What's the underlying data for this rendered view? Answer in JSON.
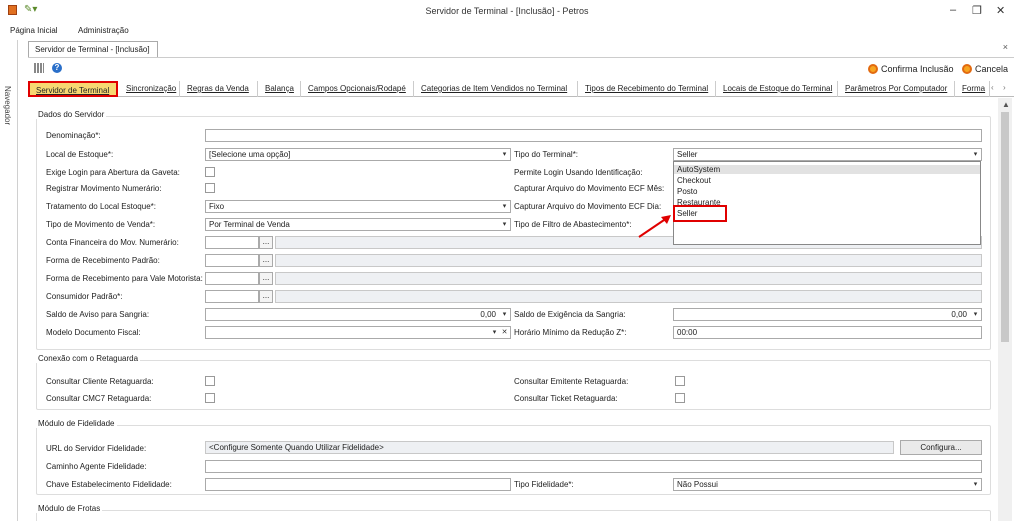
{
  "app": {
    "title": "Servidor de Terminal - [Inclusão] - Petros"
  },
  "window_controls": {
    "minimize": "–",
    "restore": "❐",
    "close": "✕"
  },
  "menu": {
    "items": [
      "Página Inicial",
      "Administração"
    ]
  },
  "navigator": {
    "label": "Navegador"
  },
  "doc_tab": {
    "label": "Servidor de Terminal - [Inclusão]",
    "close": "×"
  },
  "toolbar": {
    "confirm": "Confirma Inclusão",
    "cancel": "Cancela"
  },
  "tabs": [
    "Servidor de Terminal",
    "Sincronização",
    "Regras da Venda",
    "Balança",
    "Campos Opcionais/Rodapé",
    "Categorias de Item Vendidos no Terminal",
    "Tipos de Recebimento do Terminal",
    "Locais de Estoque do Terminal",
    "Parâmetros Por Computador",
    "Forma"
  ],
  "groups": {
    "dados": "Dados do Servidor",
    "conexao": "Conexão com o Retaguarda",
    "fidelidade": "Módulo de Fidelidade",
    "frotas": "Módulo de Frotas"
  },
  "form": {
    "denominacao": {
      "label": "Denominação*:",
      "value": ""
    },
    "local_estoque": {
      "label": "Local de Estoque*:",
      "value": "[Selecione uma opção]"
    },
    "exige_login": {
      "label": "Exige Login para Abertura da Gaveta:"
    },
    "registrar_mov": {
      "label": "Registrar Movimento Numerário:"
    },
    "tratamento": {
      "label": "Tratamento do Local Estoque*:",
      "value": "Fixo"
    },
    "tipo_mov": {
      "label": "Tipo de Movimento de Venda*:",
      "value": "Por Terminal de Venda"
    },
    "conta_fin": {
      "label": "Conta Financeira do Mov. Numerário:"
    },
    "forma_receb": {
      "label": "Forma de Recebimento Padrão:"
    },
    "forma_vale": {
      "label": "Forma de Recebimento para Vale Motorista:"
    },
    "consumidor": {
      "label": "Consumidor Padrão*:"
    },
    "saldo_aviso": {
      "label": "Saldo de Aviso para Sangria:",
      "value": "0,00"
    },
    "modelo_doc": {
      "label": "Modelo Documento Fiscal:"
    },
    "tipo_terminal": {
      "label": "Tipo do Terminal*:",
      "value": "Seller"
    },
    "permite_login": {
      "label": "Permite Login Usando Identificação:"
    },
    "capt_mes": {
      "label": "Capturar Arquivo do Movimento ECF Mês:"
    },
    "capt_dia": {
      "label": "Capturar Arquivo do Movimento ECF Dia:"
    },
    "tipo_filtro": {
      "label": "Tipo de Filtro de Abastecimento*:"
    },
    "saldo_exig": {
      "label": "Saldo de Exigência da Sangria:",
      "value": "0,00"
    },
    "horario": {
      "label": "Horário Mínimo da Redução Z*:",
      "value": "00:00"
    }
  },
  "dropdown_options": [
    "AutoSystem",
    "Checkout",
    "Posto",
    "Restaurante",
    "Seller"
  ],
  "conexao": {
    "cliente": "Consultar Cliente Retaguarda:",
    "cmc7": "Consultar CMC7 Retaguarda:",
    "emitente": "Consultar Emitente Retaguarda:",
    "ticket": "Consultar Ticket Retaguarda:"
  },
  "fidelidade": {
    "url_label": "URL do Servidor Fidelidade:",
    "url_value": "<Configure Somente Quando Utilizar Fidelidade>",
    "configura": "Configura...",
    "caminho_label": "Caminho Agente Fidelidade:",
    "chave_label": "Chave Estabelecimento Fidelidade:",
    "tipo_label": "Tipo Fidelidade*:",
    "tipo_value": "Não Possui"
  },
  "dots": "...",
  "colors": {
    "active_tab_bg": "#f7d872",
    "highlight": "#e00000",
    "orange": "#f7a520"
  }
}
